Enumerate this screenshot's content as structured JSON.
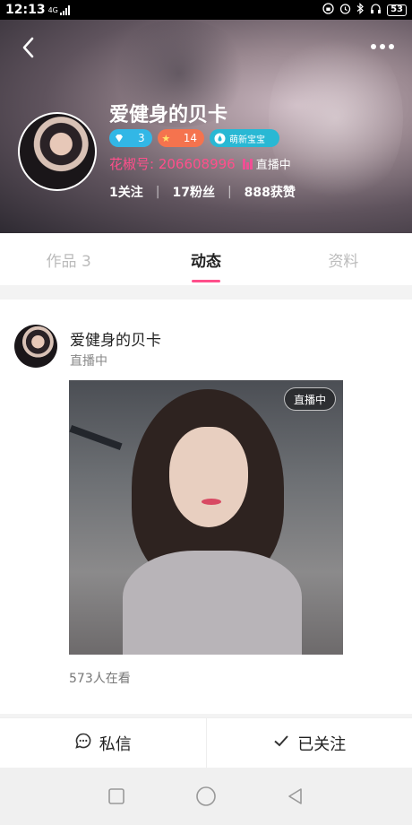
{
  "status_bar": {
    "time": "12:13",
    "network": "4G",
    "battery": "53"
  },
  "profile": {
    "name": "爱健身的贝卡",
    "badge_diamond": "3",
    "badge_star": "14",
    "badge_rank": "萌新宝宝",
    "id_text": "花椒号: 206608996",
    "live_label": "直播中",
    "following": "1关注",
    "fans": "17粉丝",
    "likes": "888获赞"
  },
  "tabs": [
    {
      "label": "作品 3"
    },
    {
      "label": "动态"
    },
    {
      "label": "资料"
    }
  ],
  "post": {
    "name": "爱健身的贝卡",
    "status": "直播中",
    "live_badge": "直播中",
    "viewers": "573人在看"
  },
  "actions": {
    "message": "私信",
    "followed": "已关注"
  },
  "colors": {
    "accent": "#ff4f8b",
    "diamond_badge": "#32b7e6",
    "star_badge": "#f5734e"
  }
}
